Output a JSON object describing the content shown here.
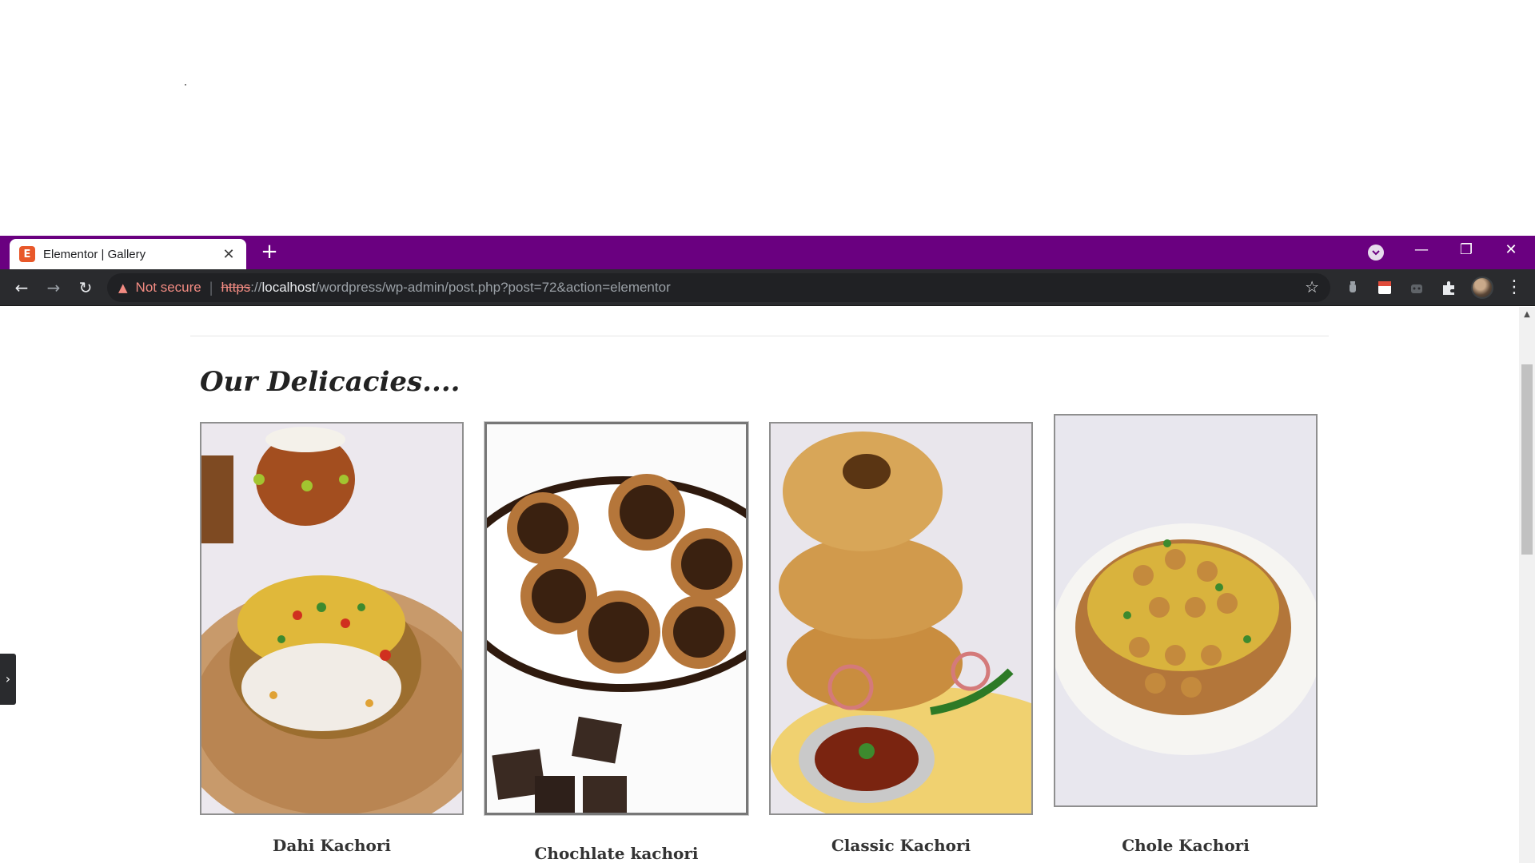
{
  "browser": {
    "tab": {
      "favicon_letter": "E",
      "title": "Elementor | Gallery",
      "close_glyph": "✕"
    },
    "new_tab_glyph": "+",
    "window_controls": {
      "minimize": "—",
      "restore": "❐",
      "close": "✕"
    },
    "nav": {
      "back": "←",
      "forward": "→",
      "reload": "↻"
    },
    "omnibox": {
      "security_label": "Not secure",
      "separator": "|",
      "url_scheme": "https",
      "url_slashes": "://",
      "url_host": "localhost",
      "url_path": "/wordpress/wp-admin/post.php?post=72&action=elementor"
    },
    "icons": {
      "bookmark": "star-icon",
      "extensions": "puzzle-icon",
      "menu": "more-vertical-icon",
      "tab_search": "chevron-down-icon"
    },
    "colors": {
      "tab_strip": "#6a0080",
      "toolbar": "#2a2b2e",
      "insecure": "#f28b82"
    }
  },
  "page": {
    "heading": "Our Delicacies....",
    "gallery": [
      {
        "caption": "Dahi Kachori",
        "image": "dahi-kachori-photo"
      },
      {
        "caption": "Chochlate kachori",
        "image": "chocolate-kachori-photo"
      },
      {
        "caption": "Classic Kachori",
        "image": "classic-kachori-photo"
      },
      {
        "caption": "Chole Kachori",
        "image": "chole-kachori-photo"
      }
    ],
    "panel_toggle_glyph": "›"
  }
}
